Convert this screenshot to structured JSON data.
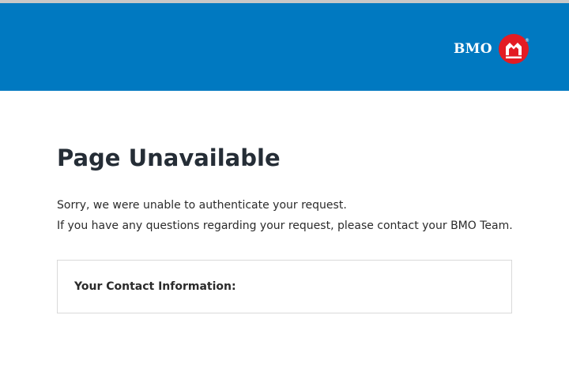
{
  "header": {
    "logo_text": "BMO",
    "logo_registered": "®",
    "logo_icon": "bmo-roundel-icon",
    "colors": {
      "header_bg": "#0079c1",
      "roundel_red": "#e31b23",
      "top_strip": "#c8c8c8"
    }
  },
  "main": {
    "title": "Page Unavailable",
    "message_line_1": "Sorry, we were unable to authenticate your request.",
    "message_line_2": "If you have any questions regarding your request, please contact your BMO Team.",
    "contact_label": "Your Contact Information:"
  }
}
